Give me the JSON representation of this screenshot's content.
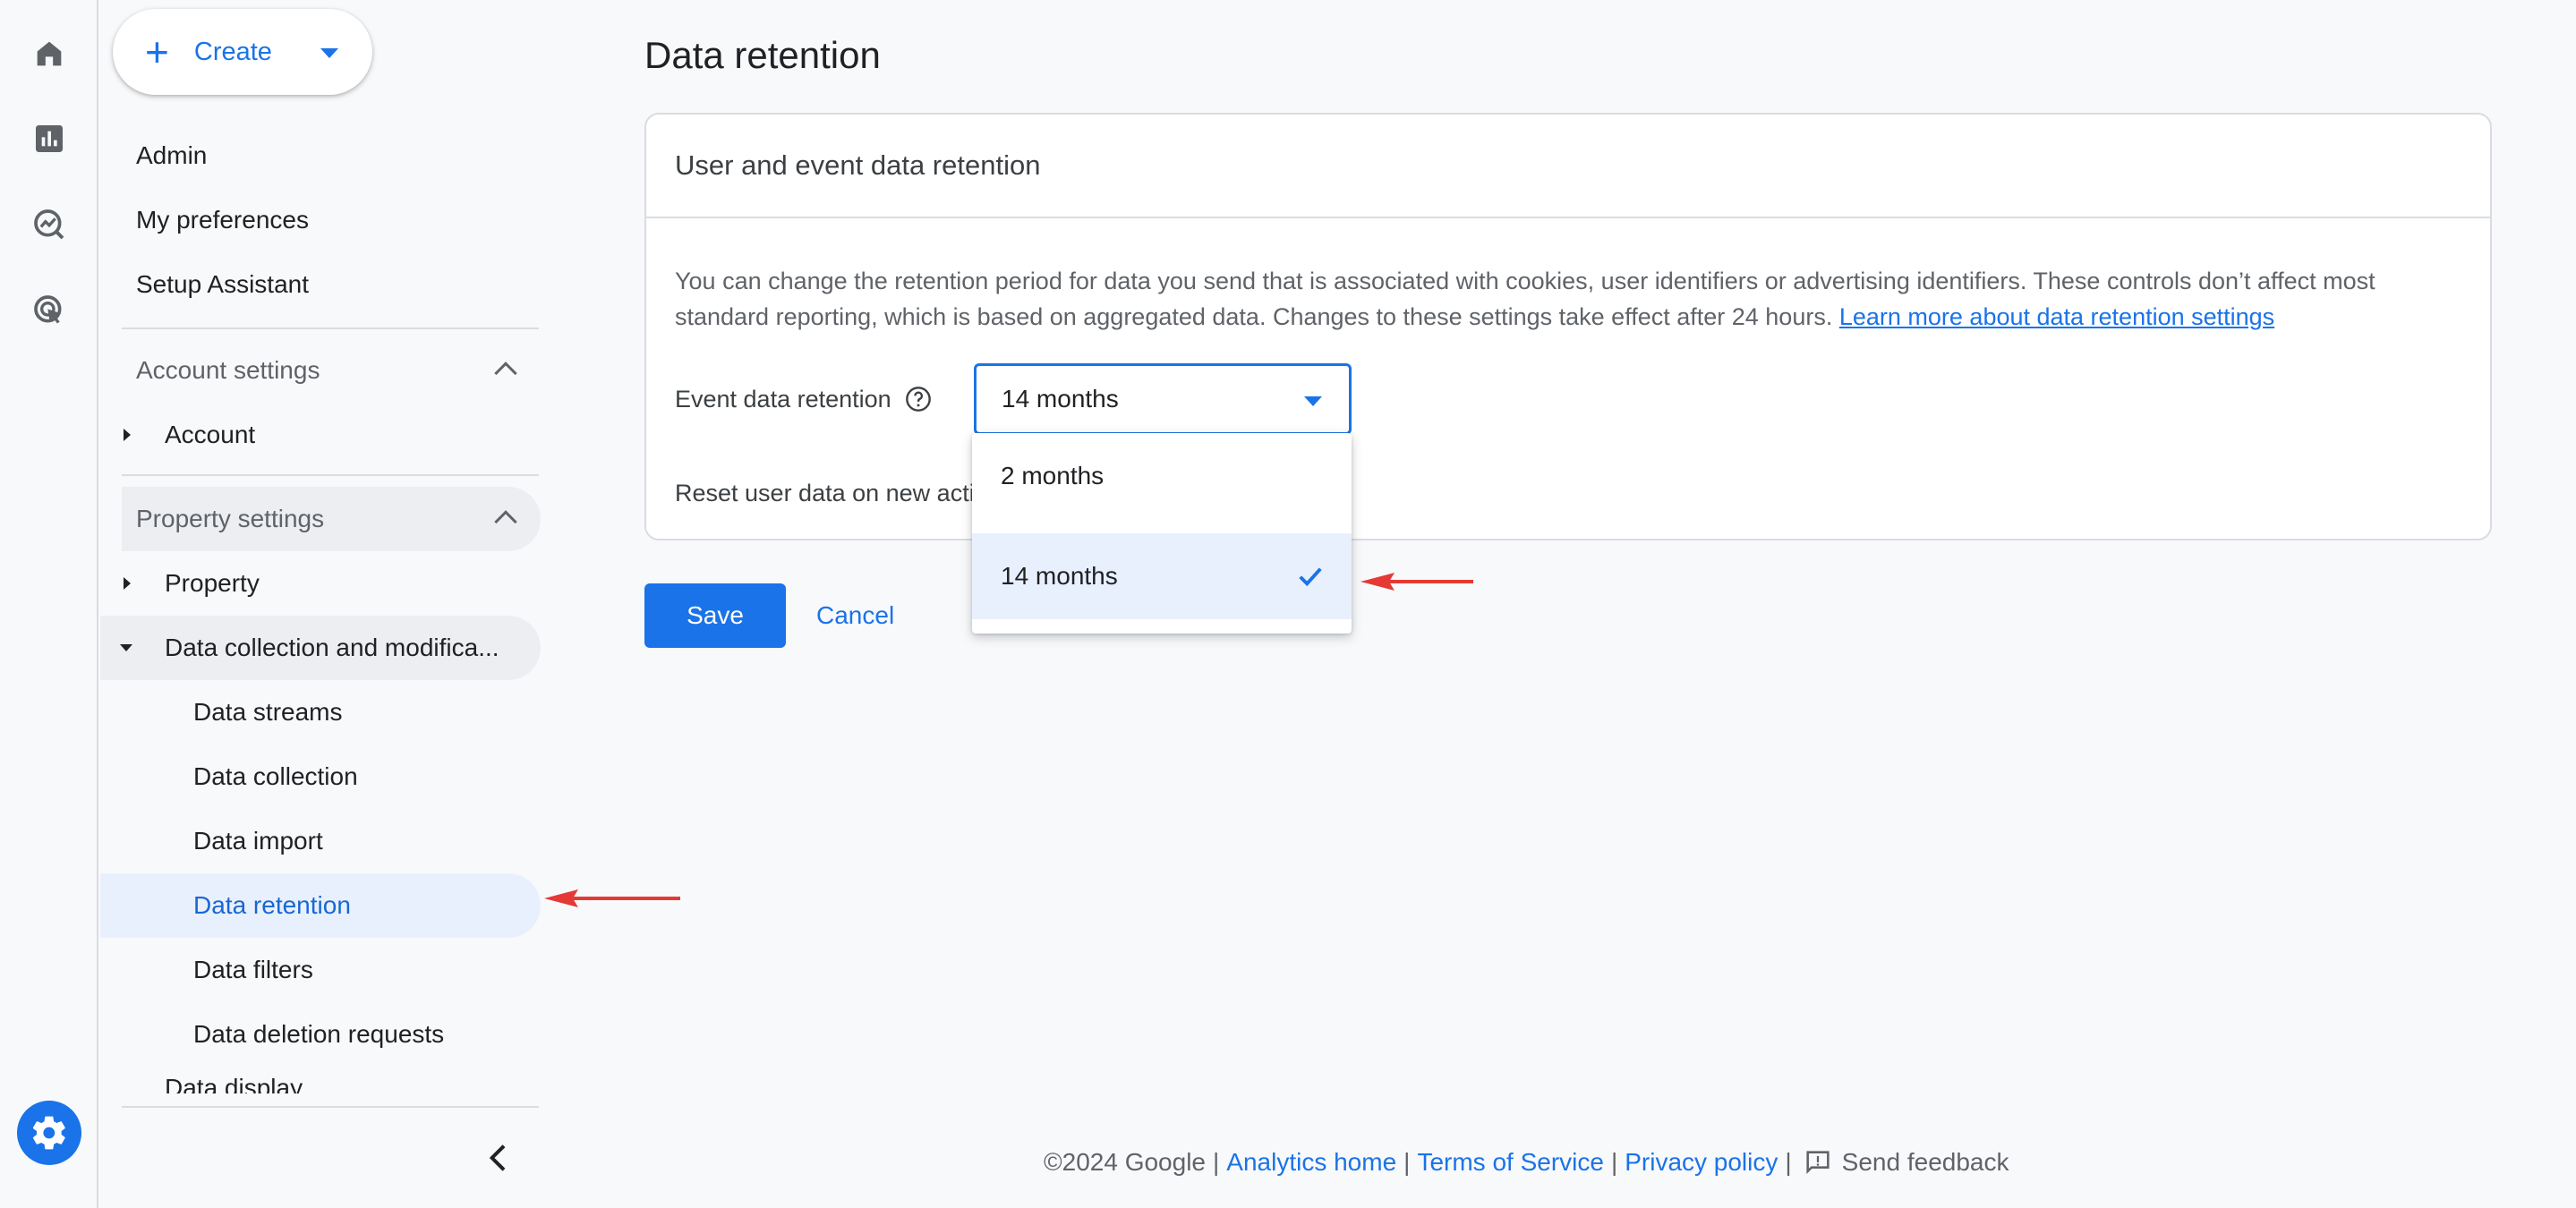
{
  "rail": {
    "icons": [
      "home-icon",
      "reports-icon",
      "explore-icon",
      "advertising-icon",
      "admin-gear-icon"
    ]
  },
  "sidebar": {
    "create_label": "Create",
    "top_items": [
      "Admin",
      "My preferences",
      "Setup Assistant"
    ],
    "account_settings": {
      "label": "Account settings",
      "items": [
        "Account"
      ]
    },
    "property_settings": {
      "label": "Property settings",
      "items": [
        "Property",
        "Data collection and modifica..."
      ],
      "sub_items": [
        "Data streams",
        "Data collection",
        "Data import",
        "Data retention",
        "Data filters",
        "Data deletion requests"
      ],
      "selected": "Data retention",
      "cut_off_item": "Data display"
    }
  },
  "main": {
    "title": "Data retention",
    "card": {
      "header": "User and event data retention",
      "description": "You can change the retention period for data you send that is associated with cookies, user identifiers or advertising identifiers. These controls don’t affect most standard reporting, which is based on aggregated data. Changes to these settings take effect after 24 hours.",
      "learn_more": "Learn more about data retention settings",
      "event_label": "Event data retention",
      "event_value": "14 months",
      "reset_label": "Reset user data on new activity"
    },
    "save_label": "Save",
    "cancel_label": "Cancel"
  },
  "dropdown": {
    "options": [
      "2 months",
      "14 months"
    ],
    "selected": "14 months"
  },
  "footer": {
    "copyright": "©2024 Google",
    "links": [
      "Analytics home",
      "Terms of Service",
      "Privacy policy"
    ],
    "feedback": "Send feedback"
  },
  "colors": {
    "accent": "#1a73e8",
    "selected_bg": "#e8f0fe",
    "annotation_arrow": "#e53935"
  }
}
